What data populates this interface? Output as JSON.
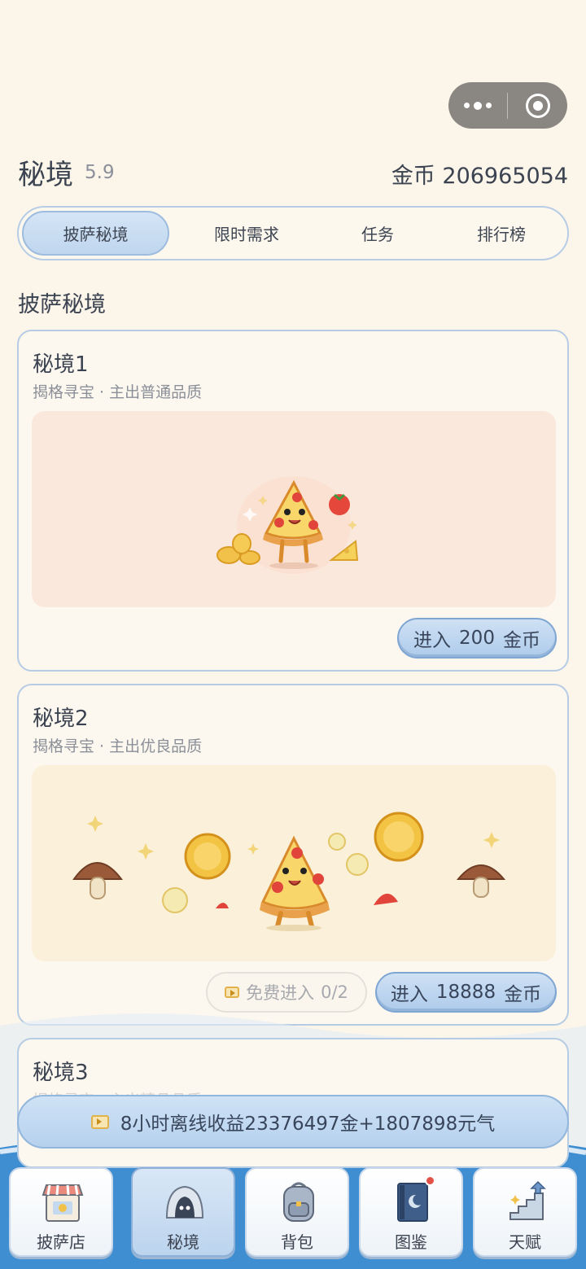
{
  "header": {
    "title": "秘境",
    "version": "5.9",
    "coins": "金币 206965054"
  },
  "tabs": [
    {
      "label": "披萨秘境",
      "active": true
    },
    {
      "label": "限时需求",
      "active": false
    },
    {
      "label": "任务",
      "active": false
    },
    {
      "label": "排行榜",
      "active": false
    }
  ],
  "section_title": "披萨秘境",
  "realms": [
    {
      "name": "秘境1",
      "desc": "揭格寻宝 · 主出普通品质",
      "enter_label": "进入",
      "enter_cost": "200",
      "enter_unit": "金币"
    },
    {
      "name": "秘境2",
      "desc": "揭格寻宝 · 主出优良品质",
      "free_label": "免费进入",
      "free_count": "0/2",
      "enter_label": "进入",
      "enter_cost": "18888",
      "enter_unit": "金币"
    },
    {
      "name": "秘境3",
      "desc": "揭格寻宝 · 主出精品品质"
    }
  ],
  "offline_reward": "8小时离线收益23376497金+1807898元气",
  "bottom_nav": [
    {
      "label": "披萨店",
      "icon": "pizza-shop-icon",
      "active": false
    },
    {
      "label": "秘境",
      "icon": "realm-cave-icon",
      "active": true
    },
    {
      "label": "背包",
      "icon": "backpack-icon",
      "active": false
    },
    {
      "label": "图鉴",
      "icon": "codex-book-icon",
      "active": false,
      "badge": true
    },
    {
      "label": "天赋",
      "icon": "talent-stairs-icon",
      "active": false
    }
  ],
  "colors": {
    "background": "#fbf5ea",
    "accent_blue": "#b6cbe4",
    "badge_red": "#e25248"
  }
}
